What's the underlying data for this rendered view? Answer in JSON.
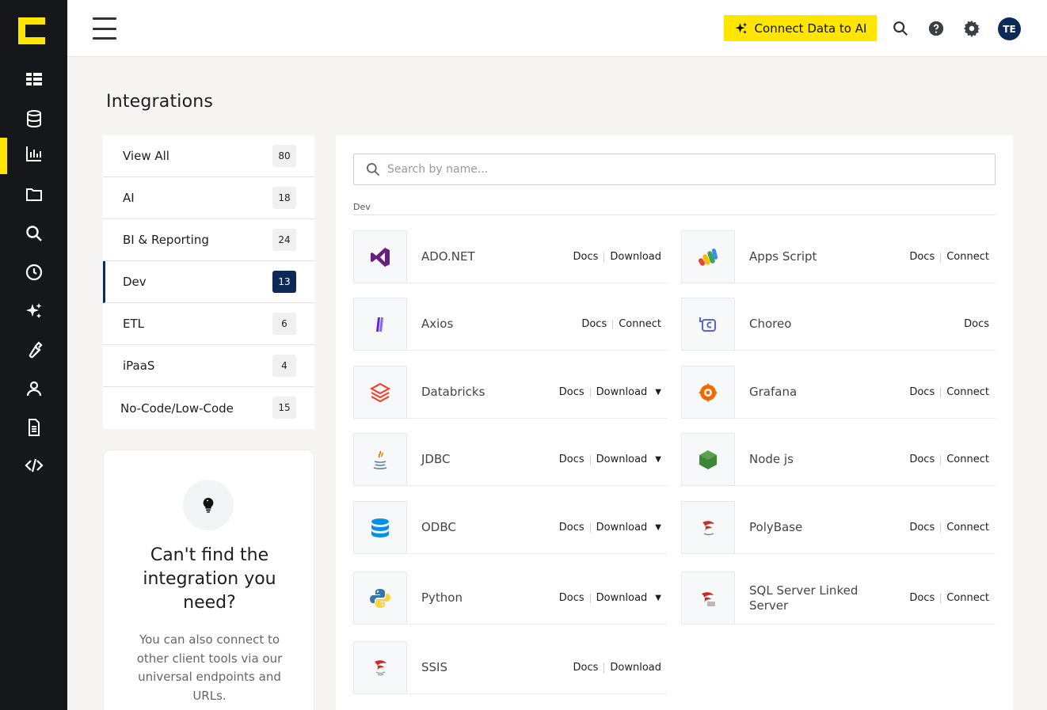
{
  "rail": {
    "items": [
      {
        "icon": "dashboard-icon"
      },
      {
        "icon": "database-icon"
      },
      {
        "icon": "bar-chart-icon",
        "active": true
      },
      {
        "icon": "folder-icon"
      },
      {
        "icon": "search-icon"
      },
      {
        "icon": "history-icon"
      },
      {
        "icon": "sparkles-icon"
      },
      {
        "icon": "wrench-icon"
      },
      {
        "icon": "user-icon"
      },
      {
        "icon": "document-icon"
      },
      {
        "icon": "code-icon"
      }
    ],
    "accent": "#ffe600"
  },
  "topbar": {
    "connect_label": "Connect Data to AI",
    "avatar_initials": "TE"
  },
  "page": {
    "title": "Integrations"
  },
  "categories": [
    {
      "label": "View All",
      "count": "80"
    },
    {
      "label": "AI",
      "count": "18"
    },
    {
      "label": "BI & Reporting",
      "count": "24"
    },
    {
      "label": "Dev",
      "count": "13",
      "active": true
    },
    {
      "label": "ETL",
      "count": "6"
    },
    {
      "label": "iPaaS",
      "count": "4"
    },
    {
      "label": "No-Code/Low-Code",
      "count": "15"
    }
  ],
  "help": {
    "title": "Can't find the integration you need?",
    "text": "You can also connect to other client tools via our universal endpoints and URLs."
  },
  "search": {
    "placeholder": "Search by name..."
  },
  "section": {
    "label": "Dev"
  },
  "integrations": [
    {
      "name": "ADO.NET",
      "docs": "Docs",
      "action": "Download",
      "dropdown": false,
      "icon": "visual-studio-icon"
    },
    {
      "name": "Apps Script",
      "docs": "Docs",
      "action": "Connect",
      "dropdown": false,
      "icon": "apps-script-icon"
    },
    {
      "name": "Axios",
      "docs": "Docs",
      "action": "Connect",
      "dropdown": false,
      "icon": "axios-icon"
    },
    {
      "name": "Choreo",
      "docs": "Docs",
      "action": "",
      "dropdown": false,
      "icon": "choreo-icon"
    },
    {
      "name": "Databricks",
      "docs": "Docs",
      "action": "Download",
      "dropdown": true,
      "icon": "databricks-icon"
    },
    {
      "name": "Grafana",
      "docs": "Docs",
      "action": "Connect",
      "dropdown": false,
      "icon": "grafana-icon"
    },
    {
      "name": "JDBC",
      "docs": "Docs",
      "action": "Download",
      "dropdown": true,
      "icon": "java-icon"
    },
    {
      "name": "Node js",
      "docs": "Docs",
      "action": "Connect",
      "dropdown": false,
      "icon": "nodejs-icon"
    },
    {
      "name": "ODBC",
      "docs": "Docs",
      "action": "Download",
      "dropdown": true,
      "icon": "odbc-database-icon"
    },
    {
      "name": "PolyBase",
      "docs": "Docs",
      "action": "Connect",
      "dropdown": false,
      "icon": "sql-server-icon"
    },
    {
      "name": "Python",
      "docs": "Docs",
      "action": "Download",
      "dropdown": true,
      "icon": "python-icon"
    },
    {
      "name": "SQL Server Linked Server",
      "docs": "Docs",
      "action": "Connect",
      "dropdown": false,
      "icon": "sql-server-linked-icon"
    },
    {
      "name": "SSIS",
      "docs": "Docs",
      "action": "Download",
      "dropdown": false,
      "icon": "ssis-icon"
    }
  ]
}
